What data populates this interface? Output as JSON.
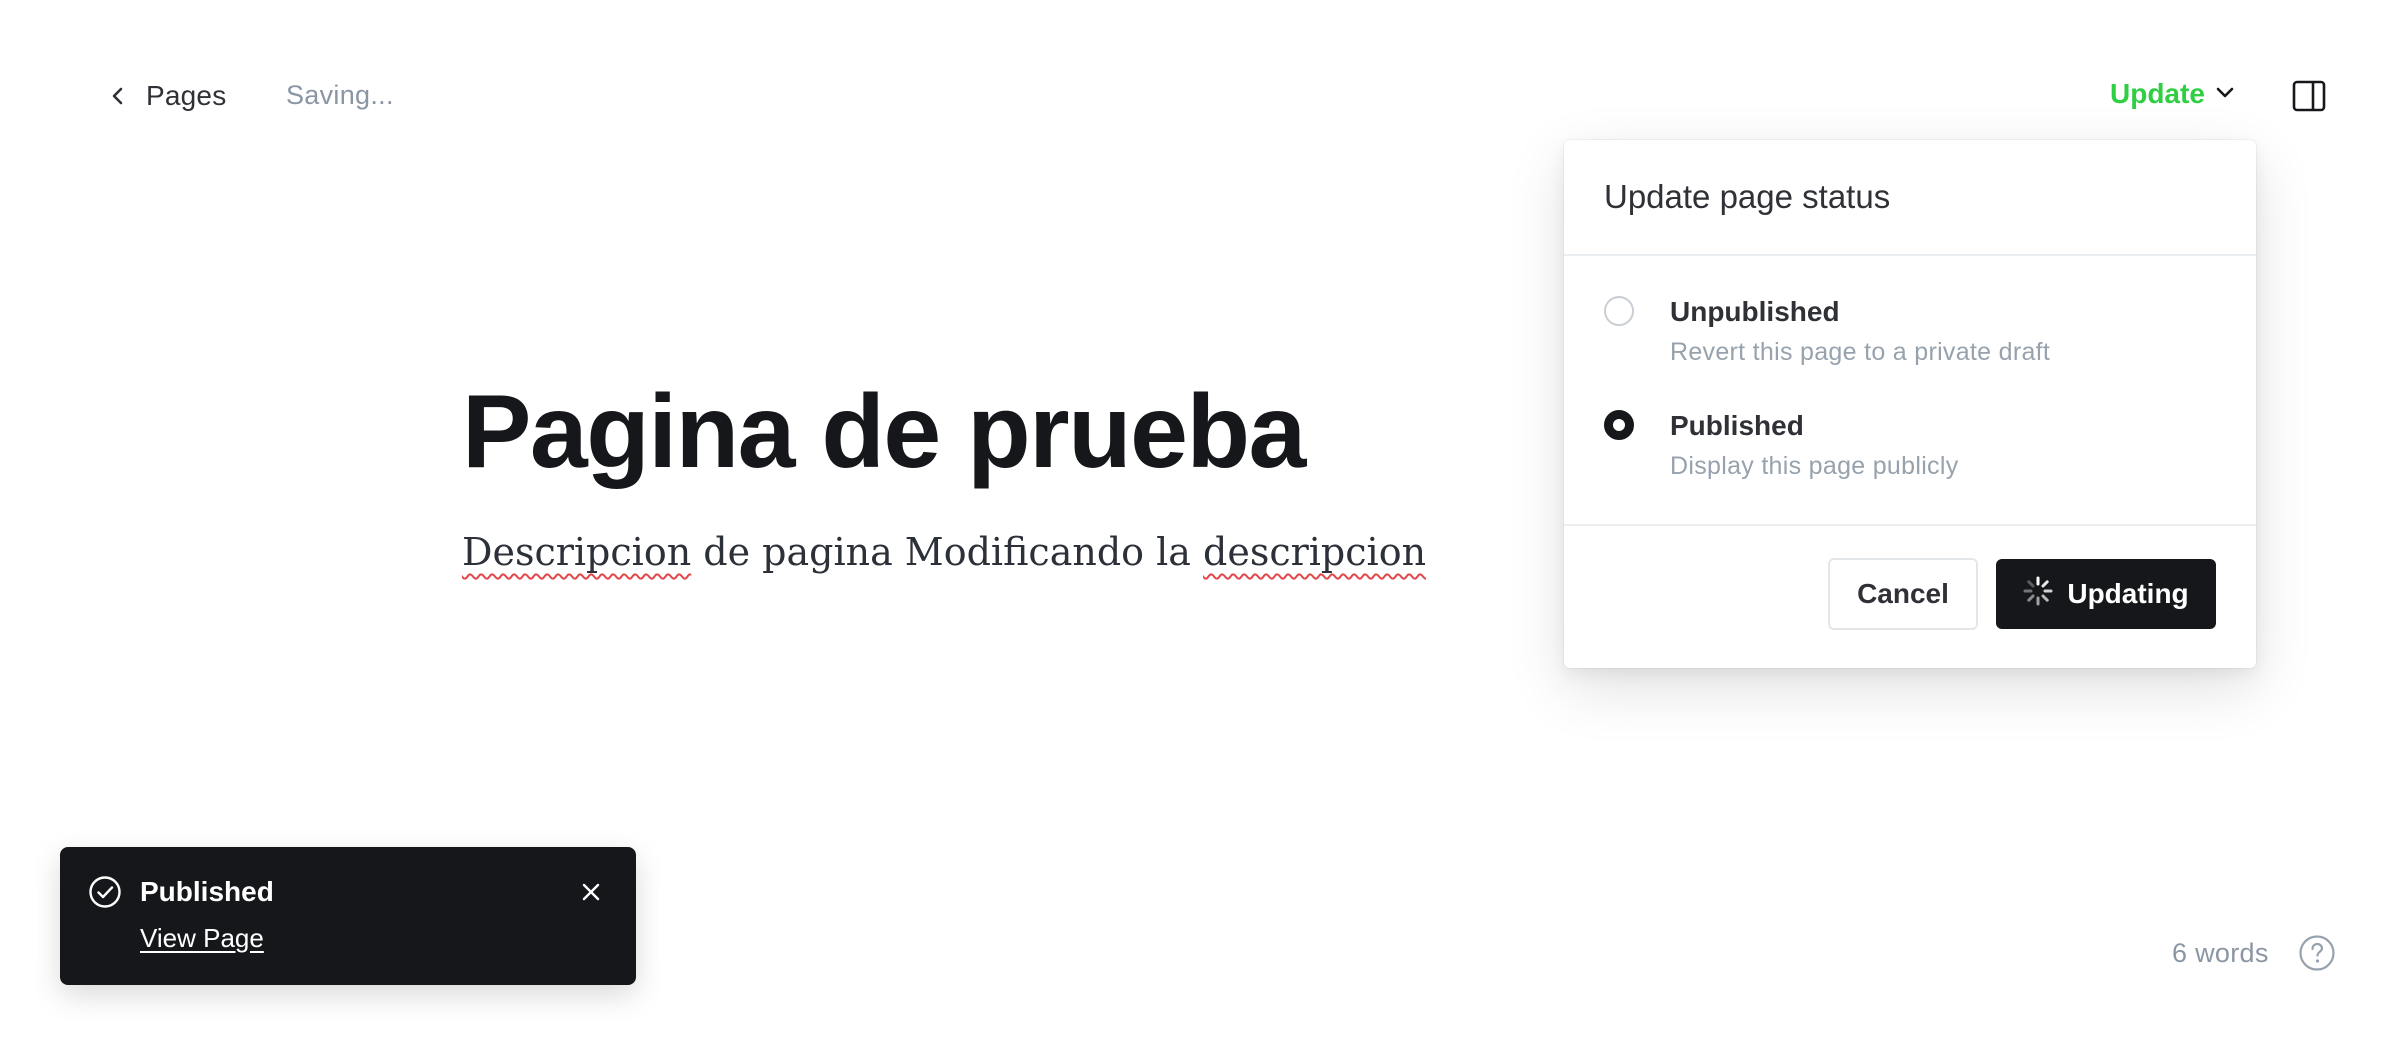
{
  "topbar": {
    "back_label": "Pages",
    "save_status": "Saving...",
    "update_label": "Update"
  },
  "editor": {
    "title": "Pagina de prueba",
    "description_parts": [
      "Descripcion",
      " de pagina Modificando la ",
      "descripcion"
    ]
  },
  "status_popover": {
    "title": "Update page status",
    "options": [
      {
        "label": "Unpublished",
        "description": "Revert this page to a private draft",
        "selected": false
      },
      {
        "label": "Published",
        "description": "Display this page publicly",
        "selected": true
      }
    ],
    "cancel_label": "Cancel",
    "confirm_label": "Updating"
  },
  "toast": {
    "title": "Published",
    "link_label": "View Page"
  },
  "footer": {
    "word_count": "6 words"
  },
  "colors": {
    "accent_green": "#30cf43",
    "dark": "#15171a",
    "muted": "#8b96a5"
  },
  "icons": [
    "chevron-left-icon",
    "chevron-down-icon",
    "sidebar-toggle-icon",
    "spinner-icon",
    "check-circle-icon",
    "close-icon",
    "help-icon"
  ]
}
